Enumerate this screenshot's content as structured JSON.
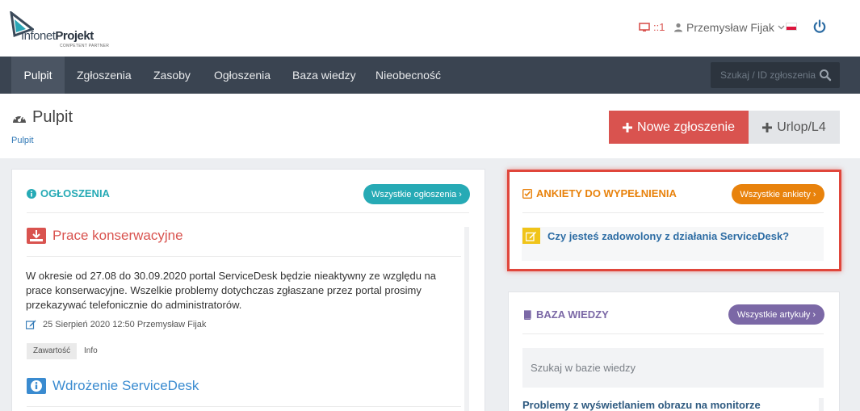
{
  "brand": {
    "name_light": "Infonet",
    "name_bold": "Projekt",
    "tagline": "COMPETENT PARTNER"
  },
  "header": {
    "monitor_count": "::1",
    "user_name": "Przemysław Fijak"
  },
  "nav": {
    "items": [
      {
        "label": "Pulpit"
      },
      {
        "label": "Zgłoszenia"
      },
      {
        "label": "Zasoby"
      },
      {
        "label": "Ogłoszenia"
      },
      {
        "label": "Baza wiedzy"
      },
      {
        "label": "Nieobecność"
      }
    ],
    "search_placeholder": "Szukaj / ID zgłoszenia"
  },
  "page": {
    "title": "Pulpit",
    "breadcrumb": "Pulpit",
    "new_ticket_label": "Nowe zgłoszenie",
    "leave_label": "Urlop/L4"
  },
  "announcements": {
    "title": "OGŁOSZENIA",
    "all_button": "Wszystkie ogłoszenia",
    "items": [
      {
        "title": "Prace konserwacyjne",
        "body": "W okresie od 27.08 do 30.09.2020 portal ServiceDesk będzie nieaktywny ze względu na prace konserwacyjne. Wszelkie problemy dotychczas zgłaszane przez portal prosimy przekazywać telefonicznie do administratorów.",
        "meta": "25 Sierpień 2020 12:50 Przemysław Fijak",
        "tag_content": "Zawartość",
        "tag_info": "Info"
      },
      {
        "title": "Wdrożenie ServiceDesk"
      }
    ]
  },
  "surveys": {
    "title": "ANKIETY DO WYPEŁNIENIA",
    "all_button": "Wszystkie ankiety",
    "items": [
      {
        "text": "Czy jesteś zadowolony z działania ServiceDesk?"
      }
    ]
  },
  "knowledge": {
    "title": "BAZA WIEDZY",
    "all_button": "Wszystkie artykuły",
    "search_placeholder": "Szukaj w bazie wiedzy",
    "items": [
      {
        "title": "Problemy z wyświetlaniem obrazu na monitorze"
      }
    ]
  },
  "colors": {
    "nav_bg": "#3a4451",
    "danger": "#d9534f",
    "teal": "#26aab5",
    "orange": "#e8820c",
    "purple": "#7b68a6",
    "link": "#337ab7"
  }
}
